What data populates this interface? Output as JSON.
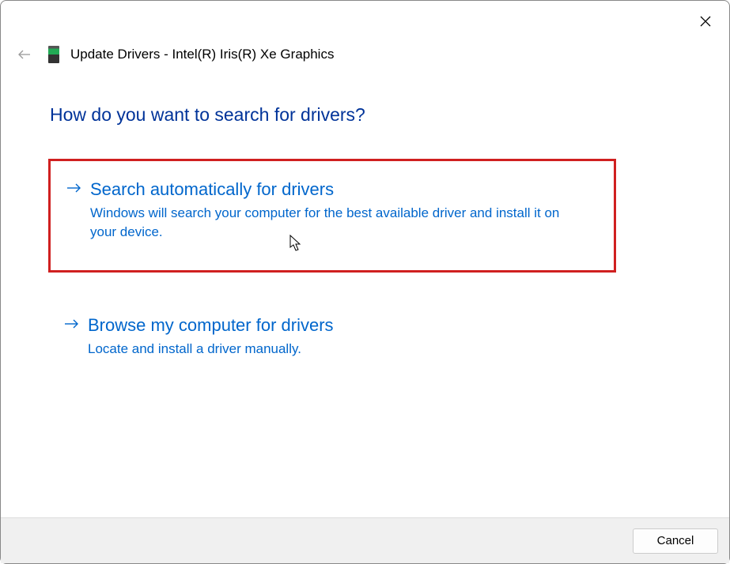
{
  "header": {
    "title": "Update Drivers - Intel(R) Iris(R) Xe Graphics"
  },
  "question": "How do you want to search for drivers?",
  "options": [
    {
      "title": "Search automatically for drivers",
      "description": "Windows will search your computer for the best available driver and install it on your device."
    },
    {
      "title": "Browse my computer for drivers",
      "description": "Locate and install a driver manually."
    }
  ],
  "footer": {
    "cancel": "Cancel"
  }
}
